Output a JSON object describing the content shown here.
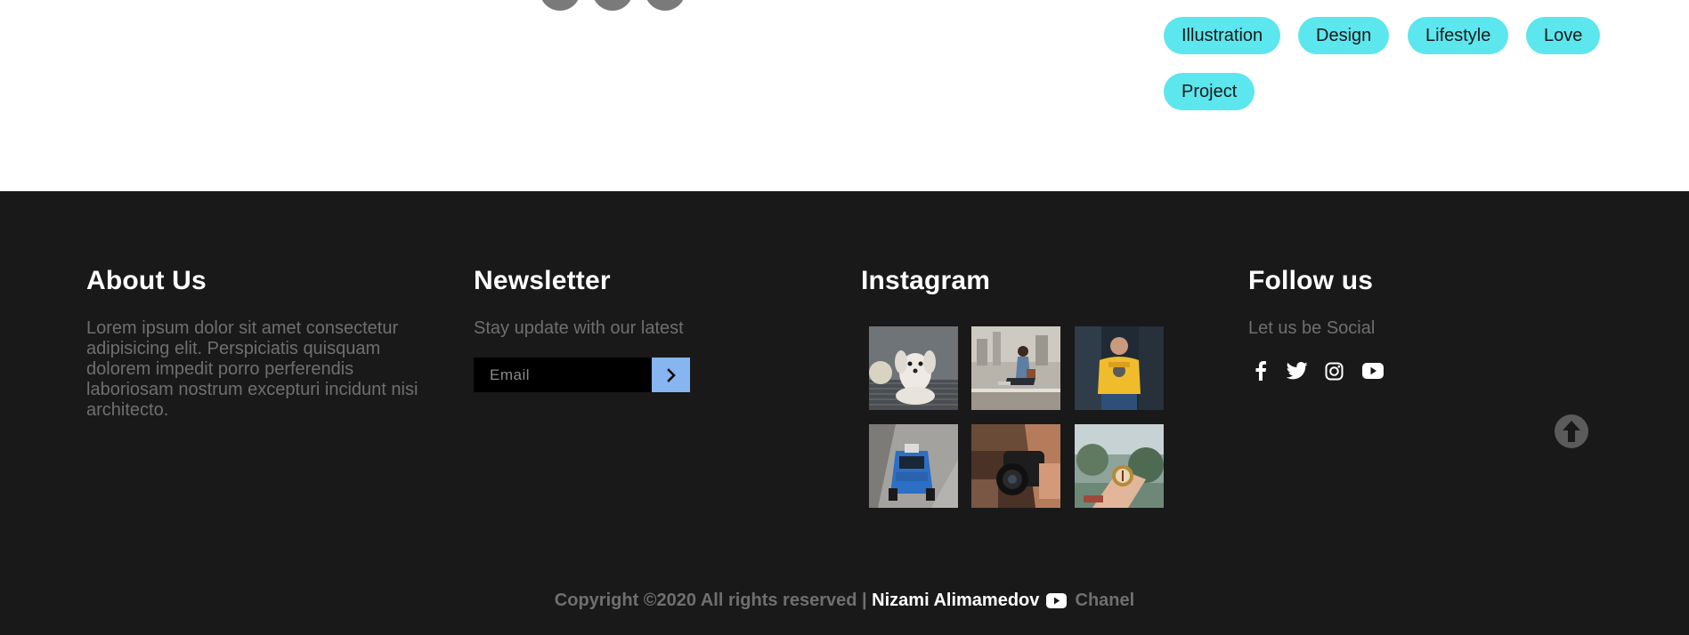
{
  "tags": [
    "Illustration",
    "Design",
    "Lifestyle",
    "Love",
    "Project"
  ],
  "footer": {
    "about": {
      "title": "About Us",
      "text": "Lorem ipsum dolor sit amet consectetur adipisicing elit. Perspiciatis quisquam dolorem impedit porro perferendis laboriosam nostrum excepturi incidunt nisi architecto."
    },
    "newsletter": {
      "title": "Newsletter",
      "subtitle": "Stay update with our latest",
      "email_placeholder": "Email"
    },
    "instagram": {
      "title": "Instagram"
    },
    "follow": {
      "title": "Follow us",
      "subtitle": "Let us be Social"
    },
    "copyright": {
      "prefix": "Copyright ©2020 All rights reserved |",
      "author": "Nizami Alimamedov",
      "suffix": "Chanel"
    }
  }
}
